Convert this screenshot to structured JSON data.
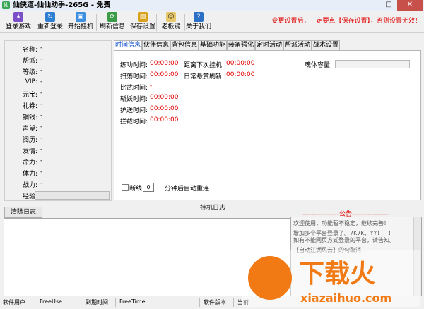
{
  "window": {
    "title": "仙侠道-仙仙助手-265G - 免费",
    "icon_label": "仙",
    "buttons": {
      "minimize": "─",
      "maximize": "□",
      "close": "✕"
    }
  },
  "toolbar": {
    "items": [
      {
        "label": "登录游戏",
        "icon": "login-icon"
      },
      {
        "label": "重新登录",
        "icon": "relogin-icon"
      },
      {
        "label": "开始挂机",
        "icon": "start-afk-icon"
      },
      {
        "label": "刷新信息",
        "icon": "refresh-icon"
      },
      {
        "label": "保存设置",
        "icon": "save-icon"
      },
      {
        "label": "老板键",
        "icon": "boss-key-icon"
      },
      {
        "label": "关于我们",
        "icon": "about-icon"
      }
    ],
    "notice": "变更设置后，一定要点【保存设置】，否则设置无效！"
  },
  "profile": {
    "rows": [
      {
        "label": "名称:",
        "value": "-"
      },
      {
        "label": "帮派:",
        "value": "-"
      },
      {
        "label": "等级:",
        "value": "-"
      },
      {
        "label": "VIP:",
        "value": "-"
      },
      {
        "label": "元宝:",
        "value": "-"
      },
      {
        "label": "礼券:",
        "value": "-"
      },
      {
        "label": "铜钱:",
        "value": "-"
      },
      {
        "label": "声望:",
        "value": "-"
      },
      {
        "label": "阅历:",
        "value": "-"
      },
      {
        "label": "友情:",
        "value": "-"
      },
      {
        "label": "命力:",
        "value": "-"
      },
      {
        "label": "体力:",
        "value": "-"
      },
      {
        "label": "战力:",
        "value": "-"
      }
    ],
    "exp_label": "经验:"
  },
  "tabs": [
    "时间信息",
    "伙伴信息",
    "背包信息",
    "基础功能",
    "装备强化",
    "定时活动",
    "帮派活动",
    "战术设置"
  ],
  "time_info": {
    "rows": [
      {
        "label": "练功时间:",
        "value": "00:00:00"
      },
      {
        "label": "扫荡时间:",
        "value": "00:00:00"
      },
      {
        "label": "比武时间:",
        "value": "-"
      },
      {
        "label": "斩妖时间:",
        "value": "00:00:00"
      },
      {
        "label": "护送时间:",
        "value": "00:00:00"
      },
      {
        "label": "拦截时间:",
        "value": "00:00:00"
      }
    ],
    "next_afk_label": "距离下次挂机:",
    "next_afk_value": "00:00:00",
    "bounty_label": "日常悬赏刷新:",
    "bounty_value": "00:00:00",
    "capacity_label": "魂体容量:",
    "disconnect_label": "断线",
    "reconnect_minutes": "0",
    "reconnect_suffix": "分钟后自动重连"
  },
  "log": {
    "title": "挂机日志",
    "clear_button": "清除日志"
  },
  "announcement": {
    "header": "----------------公告----------------",
    "lines": [
      "欢迎使用，功能暂不稳定，继续完善！",
      "增加多个平台登录了。7K7K、YY！！！",
      "如有不能网页方式登录的平台，请告知。",
      "",
      "【自动江湖风云】的勾取消"
    ]
  },
  "statusbar": {
    "user_label": "软件用户",
    "user_value": "FreeUse",
    "expiry_label": "到期时间",
    "expiry_value": "FreeTime",
    "version_label": "软件版本",
    "current_label": "当前"
  },
  "watermark": {
    "text": "下载火",
    "url": "xiazaihuo.com",
    "color": "#f27a14"
  }
}
